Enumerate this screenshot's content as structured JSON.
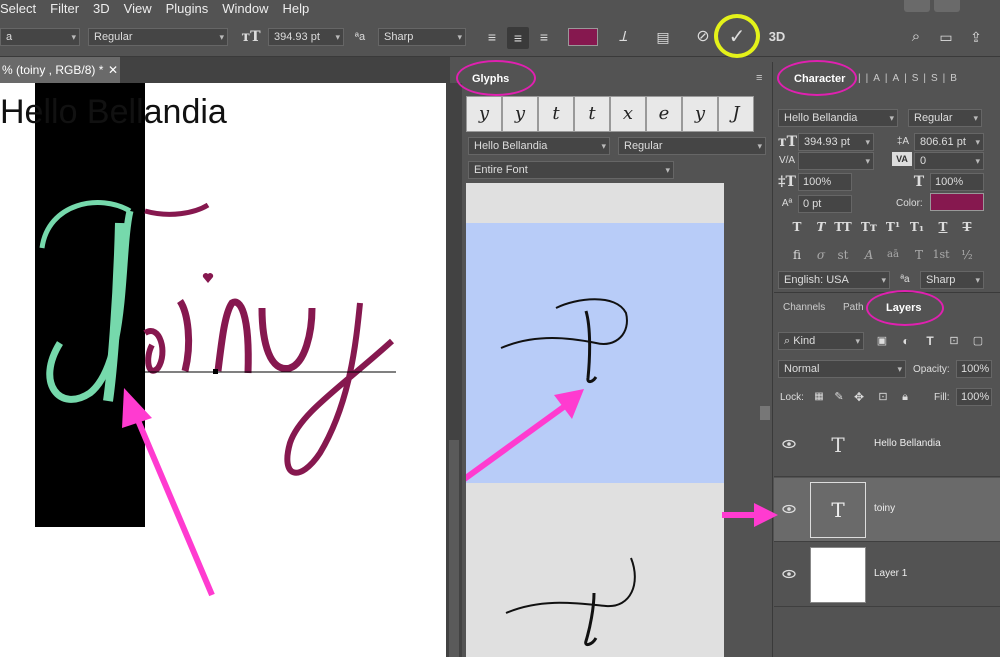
{
  "menu": [
    "Select",
    "Filter",
    "3D",
    "View",
    "Plugins",
    "Window",
    "Help"
  ],
  "options": {
    "font_family_partial": "a",
    "font_style": "Regular",
    "font_size": "394.93 pt",
    "aa_method": "Sharp",
    "threed_label": "3D",
    "text_color": "#86184f"
  },
  "doc_tab": "% (toiny , RGB/8) *",
  "canvas": {
    "top_text": "Hello Bellandia",
    "script_text": "Toiny",
    "accent_color": "#76d9ac",
    "script_color": "#86184f"
  },
  "glyphs": {
    "tab": "Glyphs",
    "font": "Hello Bellandia",
    "style": "Regular",
    "filter": "Entire Font",
    "cells": [
      "y",
      "y",
      "t",
      "t",
      "x",
      "e",
      "y",
      "J"
    ]
  },
  "character": {
    "tab": "Character",
    "font": "Hello Bellandia",
    "style": "Regular",
    "size": "394.93 pt",
    "leading": "806.61 pt",
    "tracking": "0",
    "vscale": "100%",
    "hscale": "100%",
    "baseline": "0 pt",
    "color_label": "Color:",
    "color": "#86184f",
    "language": "English: USA",
    "aa": "Sharp",
    "fmt_row1": [
      "T",
      "T",
      "TT",
      "Tт",
      "T¹",
      "T₁",
      "T",
      "T"
    ],
    "fmt_row2": [
      "fi",
      "σ",
      "st",
      "A",
      "aā",
      "T",
      "1st",
      "½"
    ]
  },
  "layers_panel": {
    "tabs": [
      "Channels",
      "Path",
      "Layers"
    ],
    "kind": "Kind",
    "blend": "Normal",
    "opacity_label": "Opacity:",
    "opacity": "100%",
    "lock_label": "Lock:",
    "fill_label": "Fill:",
    "fill": "100%",
    "layers": [
      {
        "name": "Hello Bellandia",
        "type": "text",
        "selected": false
      },
      {
        "name": "toiny",
        "type": "text",
        "selected": true
      },
      {
        "name": "Layer 1",
        "type": "raster",
        "selected": false
      }
    ]
  }
}
